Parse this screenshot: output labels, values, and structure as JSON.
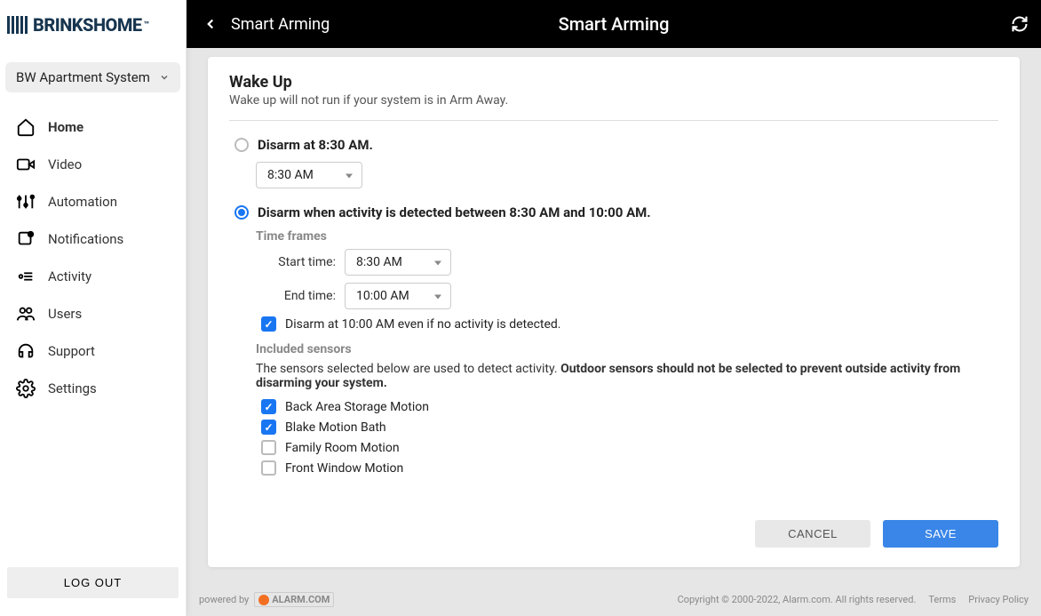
{
  "brand": {
    "name": "BRINKSHOME"
  },
  "system_selector": {
    "label": "BW Apartment System"
  },
  "sidebar": {
    "items": [
      {
        "label": "Home"
      },
      {
        "label": "Video"
      },
      {
        "label": "Automation"
      },
      {
        "label": "Notifications"
      },
      {
        "label": "Activity"
      },
      {
        "label": "Users"
      },
      {
        "label": "Support"
      },
      {
        "label": "Settings"
      }
    ],
    "logout_label": "LOG OUT"
  },
  "topbar": {
    "breadcrumb": "Smart Arming",
    "title": "Smart Arming"
  },
  "wakeup": {
    "heading": "Wake Up",
    "subhead": "Wake up will not run if your system is in Arm Away.",
    "option_fixed": {
      "label": "Disarm at 8:30 AM.",
      "time_value": "8:30 AM"
    },
    "option_activity": {
      "label": "Disarm when activity is detected between 8:30 AM and 10:00 AM.",
      "timeframes_label": "Time frames",
      "start_label": "Start time:",
      "start_value": "8:30 AM",
      "end_label": "End time:",
      "end_value": "10:00 AM",
      "fallback_label": "Disarm at 10:00 AM even if no activity is detected.",
      "sensors_heading": "Included sensors",
      "sensors_help_plain": "The sensors selected below are used to detect activity. ",
      "sensors_help_bold": "Outdoor sensors should not be selected to prevent outside activity from disarming your system.",
      "sensors": [
        {
          "label": "Back Area Storage Motion",
          "checked": true
        },
        {
          "label": "Blake Motion Bath",
          "checked": true
        },
        {
          "label": "Family Room Motion",
          "checked": false
        },
        {
          "label": "Front Window Motion",
          "checked": false
        }
      ]
    }
  },
  "buttons": {
    "cancel": "CANCEL",
    "save": "SAVE"
  },
  "footer": {
    "powered_prefix": "powered by",
    "adc_brand": "ALARM.COM",
    "copyright": "Copyright © 2000-2022, Alarm.com. All rights reserved.",
    "terms": "Terms",
    "privacy": "Privacy Policy"
  }
}
